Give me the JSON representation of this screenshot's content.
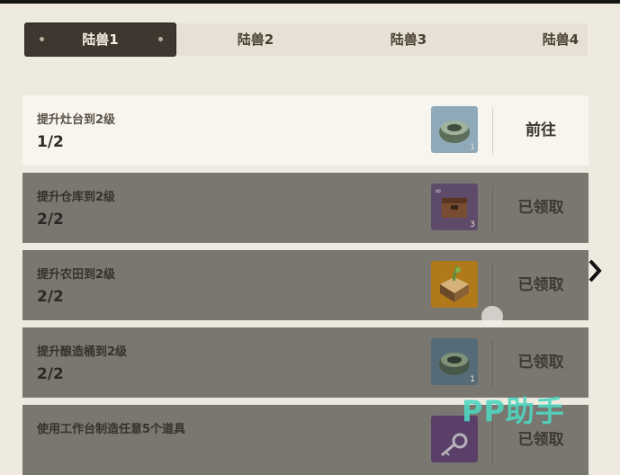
{
  "tabs": [
    {
      "label": "陆兽1",
      "active": true
    },
    {
      "label": "陆兽2",
      "active": false
    },
    {
      "label": "陆兽3",
      "active": false
    },
    {
      "label": "陆兽4",
      "active": false
    }
  ],
  "tasks": [
    {
      "title": "提升灶台到2级",
      "progress": "1/2",
      "reward_icon": "stone-cauldron-icon",
      "reward_qty": "1",
      "action": "前往",
      "status": "open"
    },
    {
      "title": "提升仓库到2级",
      "progress": "2/2",
      "reward_icon": "wooden-chest-icon",
      "reward_qty": "3",
      "action": "已领取",
      "status": "claimed"
    },
    {
      "title": "提升农田到2级",
      "progress": "2/2",
      "reward_icon": "seed-crate-icon",
      "reward_qty": "",
      "action": "已领取",
      "status": "claimed"
    },
    {
      "title": "提升酿造桶到2级",
      "progress": "2/2",
      "reward_icon": "stone-cauldron-icon",
      "reward_qty": "1",
      "action": "已领取",
      "status": "claimed"
    },
    {
      "title": "使用工作台制造任意5个道具",
      "progress": "",
      "reward_icon": "key-icon",
      "reward_qty": "",
      "action": "已领取",
      "status": "claimed"
    }
  ],
  "watermark": "PP助手",
  "colors": {
    "accent_tab": "#3e372f",
    "claimed_row": "#7a7670",
    "open_row": "#f8f5ef",
    "watermark": "#4fd7bf"
  }
}
